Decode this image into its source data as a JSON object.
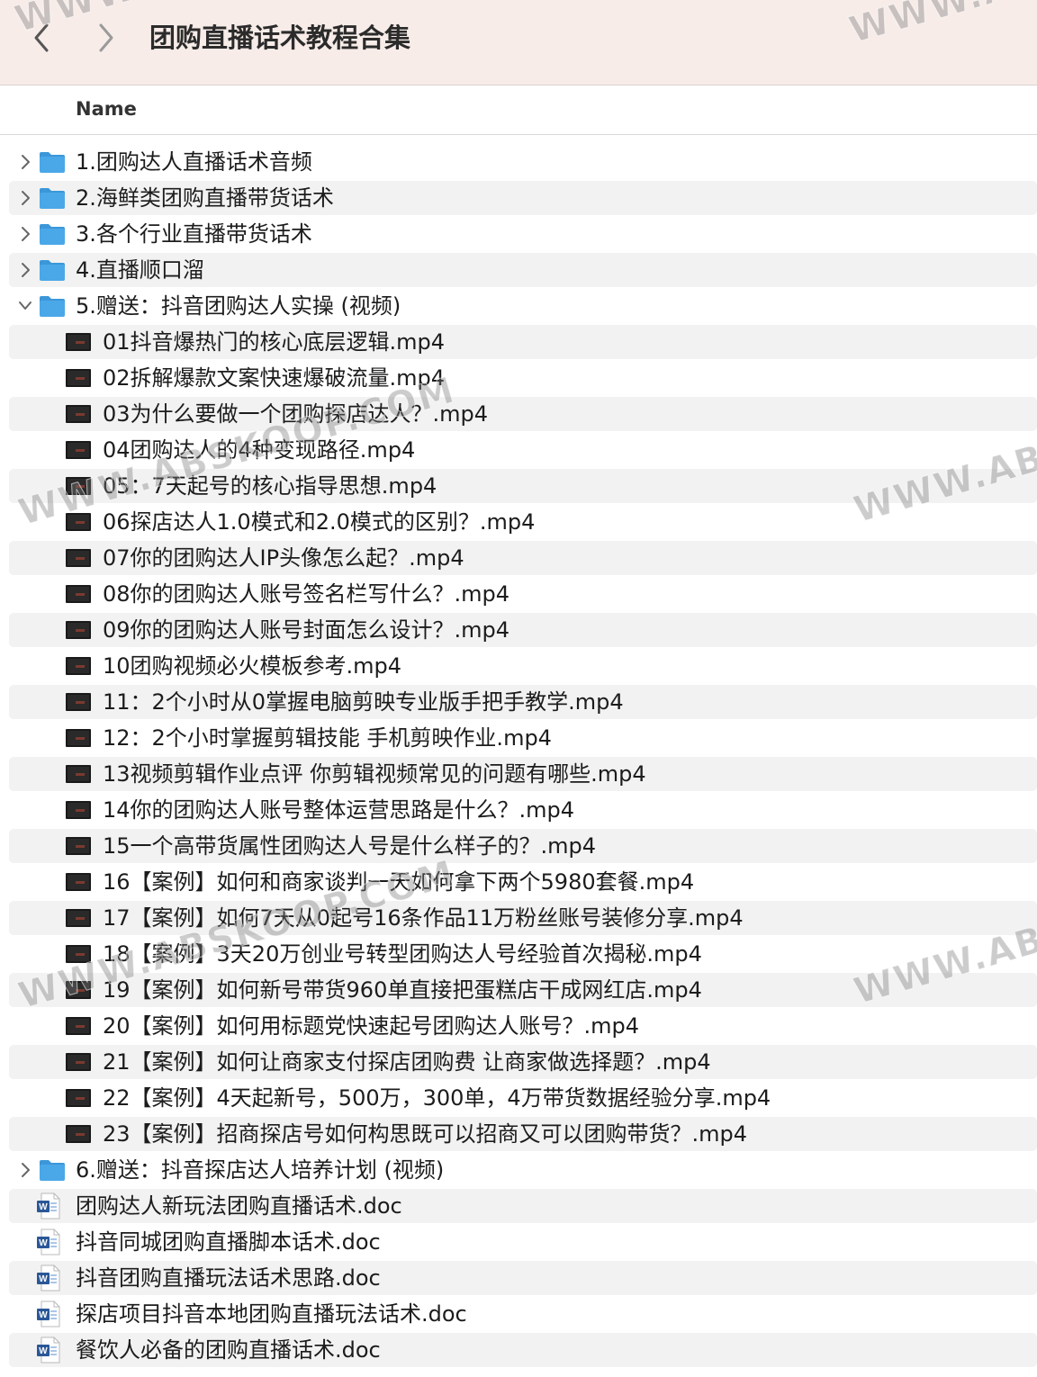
{
  "window": {
    "title": "团购直播话术教程合集",
    "back_icon": "chevron-left-icon",
    "forward_icon": "chevron-right-icon"
  },
  "header": {
    "name_column": "Name"
  },
  "colors": {
    "toolbar_bg": "#f7ece8",
    "folder_blue": "#4aa8e8",
    "row_stripe": "#f2f2f2",
    "word_blue": "#2b5797"
  },
  "items": [
    {
      "name": "1.团购达人直播话术音频",
      "kind": "folder",
      "expanded": false,
      "depth": 0
    },
    {
      "name": "2.海鲜类团购直播带货话术",
      "kind": "folder",
      "expanded": false,
      "depth": 0
    },
    {
      "name": "3.各个行业直播带货话术",
      "kind": "folder",
      "expanded": false,
      "depth": 0
    },
    {
      "name": "4.直播顺口溜",
      "kind": "folder",
      "expanded": false,
      "depth": 0
    },
    {
      "name": "5.赠送：抖音团购达人实操 (视频)",
      "kind": "folder",
      "expanded": true,
      "depth": 0
    },
    {
      "name": "01抖音爆热门的核心底层逻辑.mp4",
      "kind": "video",
      "depth": 1
    },
    {
      "name": "02拆解爆款文案快速爆破流量.mp4",
      "kind": "video",
      "depth": 1
    },
    {
      "name": "03为什么要做一个团购探店达人？.mp4",
      "kind": "video",
      "depth": 1
    },
    {
      "name": "04团购达人的4种变现路径.mp4",
      "kind": "video",
      "depth": 1
    },
    {
      "name": "05：7天起号的核心指导思想.mp4",
      "kind": "video",
      "depth": 1
    },
    {
      "name": "06探店达人1.0模式和2.0模式的区别？.mp4",
      "kind": "video",
      "depth": 1
    },
    {
      "name": "07你的团购达人IP头像怎么起？.mp4",
      "kind": "video",
      "depth": 1
    },
    {
      "name": "08你的团购达人账号签名栏写什么？.mp4",
      "kind": "video",
      "depth": 1
    },
    {
      "name": "09你的团购达人账号封面怎么设计？.mp4",
      "kind": "video",
      "depth": 1
    },
    {
      "name": "10团购视频必火模板参考.mp4",
      "kind": "video",
      "depth": 1
    },
    {
      "name": "11：2个小时从0掌握电脑剪映专业版手把手教学.mp4",
      "kind": "video",
      "depth": 1
    },
    {
      "name": "12：2个小时掌握剪辑技能 手机剪映作业.mp4",
      "kind": "video",
      "depth": 1
    },
    {
      "name": "13视频剪辑作业点评 你剪辑视频常见的问题有哪些.mp4",
      "kind": "video",
      "depth": 1
    },
    {
      "name": "14你的团购达人账号整体运营思路是什么？.mp4",
      "kind": "video",
      "depth": 1
    },
    {
      "name": "15一个高带货属性团购达人号是什么样子的？.mp4",
      "kind": "video",
      "depth": 1
    },
    {
      "name": "16【案例】如何和商家谈判一天如何拿下两个5980套餐.mp4",
      "kind": "video",
      "depth": 1
    },
    {
      "name": "17【案例】如何7天从0起号16条作品11万粉丝账号装修分享.mp4",
      "kind": "video",
      "depth": 1
    },
    {
      "name": "18【案例】3天20万创业号转型团购达人号经验首次揭秘.mp4",
      "kind": "video",
      "depth": 1
    },
    {
      "name": "19【案例】如何新号带货960单直接把蛋糕店干成网红店.mp4",
      "kind": "video",
      "depth": 1
    },
    {
      "name": "20【案例】如何用标题党快速起号团购达人账号？.mp4",
      "kind": "video",
      "depth": 1
    },
    {
      "name": "21【案例】如何让商家支付探店团购费 让商家做选择题？.mp4",
      "kind": "video",
      "depth": 1
    },
    {
      "name": "22【案例】4天起新号，500万，300单，4万带货数据经验分享.mp4",
      "kind": "video",
      "depth": 1
    },
    {
      "name": "23【案例】招商探店号如何构思既可以招商又可以团购带货？.mp4",
      "kind": "video",
      "depth": 1
    },
    {
      "name": "6.赠送：抖音探店达人培养计划 (视频)",
      "kind": "folder",
      "expanded": false,
      "depth": 0
    },
    {
      "name": "团购达人新玩法团购直播话术.doc",
      "kind": "doc",
      "depth": 0
    },
    {
      "name": "抖音同城团购直播脚本话术.doc",
      "kind": "doc",
      "depth": 0
    },
    {
      "name": "抖音团购直播玩法话术思路.doc",
      "kind": "doc",
      "depth": 0
    },
    {
      "name": "探店项目抖音本地团购直播玩法话术.doc",
      "kind": "doc",
      "depth": 0
    },
    {
      "name": "餐饮人必备的团购直播话术.doc",
      "kind": "doc",
      "depth": 0
    }
  ],
  "watermarks": [
    "WWW.ABSKOOP.COM",
    "WWW.ABSKOOP.COM",
    "WWW.ABS",
    "WWW.ABSKOOP.COM",
    "WWW.ABS",
    "WWW.ABS",
    "WWW.ABS"
  ]
}
